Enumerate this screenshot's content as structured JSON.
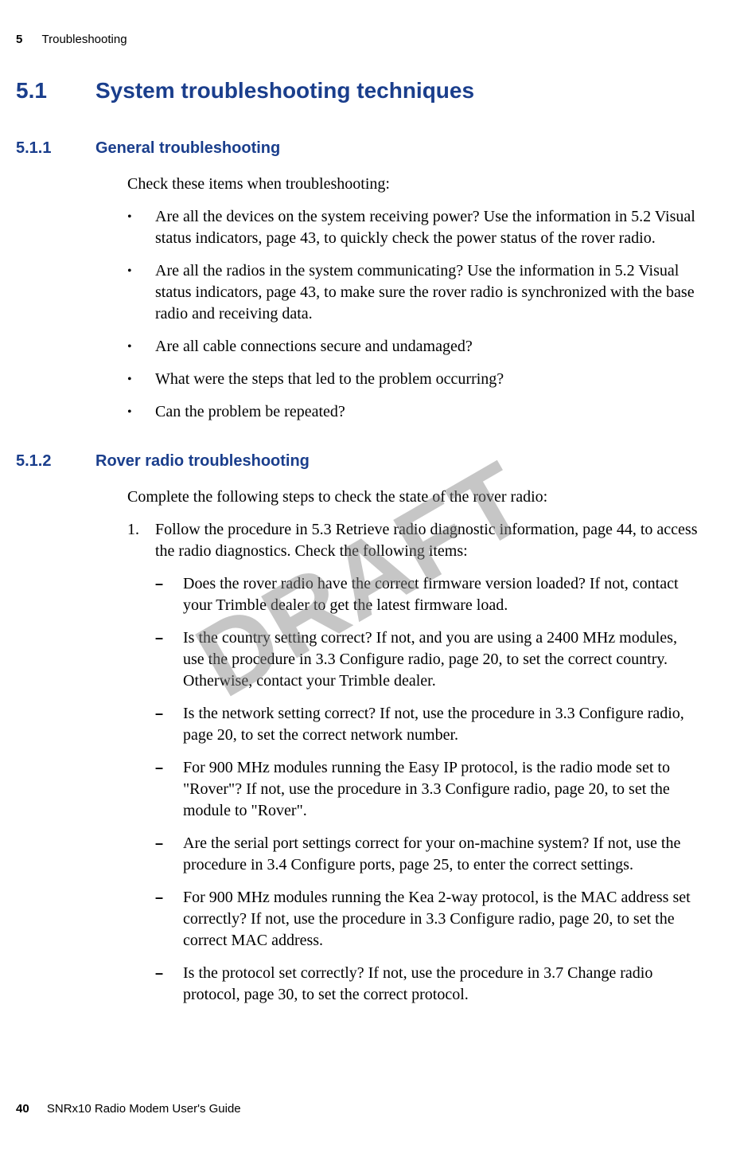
{
  "header": {
    "chapter_num": "5",
    "chapter_title": "Troubleshooting"
  },
  "h1": {
    "num": "5.1",
    "title": "System troubleshooting techniques"
  },
  "sec1": {
    "num": "5.1.1",
    "title": "General troubleshooting",
    "intro": "Check these items when troubleshooting:",
    "bullets": [
      "Are all the devices on the system receiving power? Use the information in 5.2 Visual status indicators, page 43, to quickly check the power status of the rover radio.",
      "Are all the radios in the system communicating? Use the information in 5.2 Visual status indicators, page 43, to make sure the rover radio is synchronized with the base radio and receiving data.",
      "Are all cable connections secure and undamaged?",
      "What were the steps that led to the problem occurring?",
      "Can the problem be repeated?"
    ]
  },
  "sec2": {
    "num": "5.1.2",
    "title": "Rover radio troubleshooting",
    "intro": "Complete the following steps to check the state of the rover radio:",
    "step1_num": "1.",
    "step1": "Follow the procedure in 5.3 Retrieve radio diagnostic information, page 44, to access the radio diagnostics. Check the following items:",
    "dashes": [
      "Does the rover radio have the correct firmware version loaded? If not, contact your Trimble dealer to get the latest firmware load.",
      "Is the country setting correct? If not, and you are using a 2400 MHz modules, use the procedure in 3.3 Configure radio, page 20, to set the correct country. Otherwise, contact your Trimble dealer.",
      "Is the network setting correct? If not, use the procedure in 3.3 Configure radio, page 20, to set the correct network number.",
      "For 900 MHz modules running the Easy IP protocol, is the radio mode set to \"Rover\"? If not, use the procedure in 3.3 Configure radio, page 20, to set the module to \"Rover\".",
      "Are the serial port settings correct for your on-machine system? If not, use the procedure in 3.4 Configure ports, page 25, to enter the correct settings.",
      "For 900 MHz modules running the Kea 2-way protocol, is the MAC address set correctly? If not, use the procedure in 3.3 Configure radio, page 20, to set the correct MAC address.",
      "Is the protocol set correctly? If not, use the procedure in 3.7 Change radio protocol, page 30, to set the correct protocol."
    ]
  },
  "watermark": "DRAFT",
  "footer": {
    "page": "40",
    "title": "SNRx10 Radio Modem User's Guide"
  }
}
